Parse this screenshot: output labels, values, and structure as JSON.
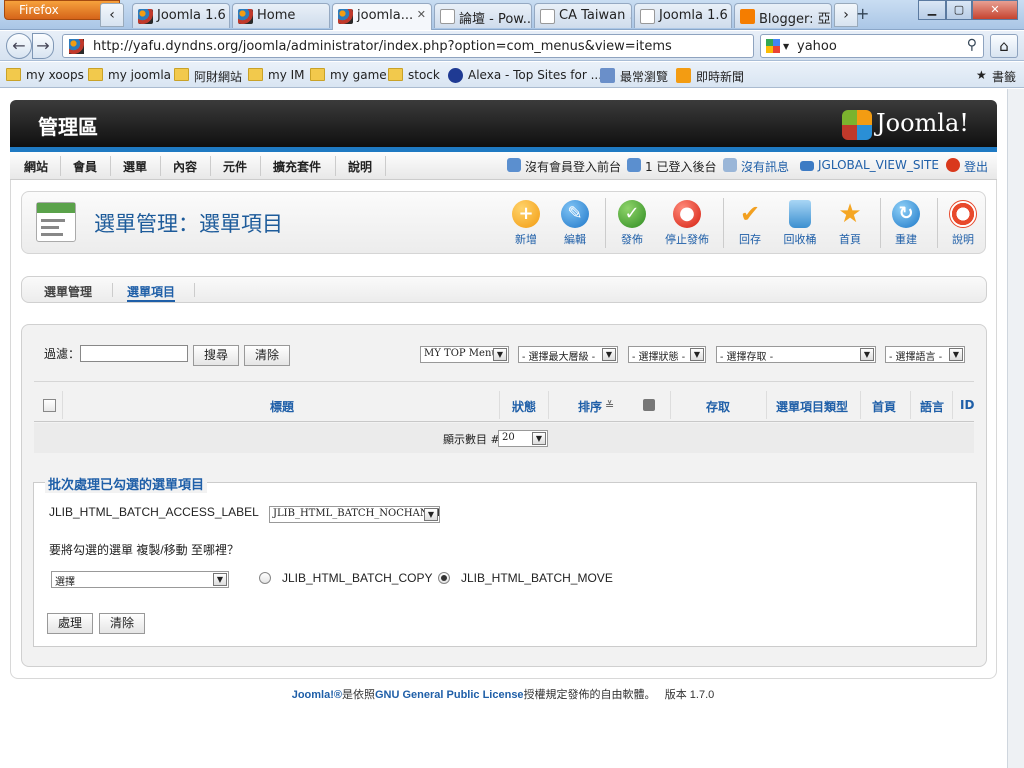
{
  "browser": {
    "app_button": "Firefox",
    "tabs": [
      {
        "label": "Joomla 1.6 ...",
        "icon": "joomla-favicon"
      },
      {
        "label": "Home",
        "icon": "joomla-favicon"
      },
      {
        "label": "joomla...",
        "icon": "joomla-favicon",
        "active": true
      },
      {
        "label": "論壇 - Pow...",
        "icon": "page-favicon"
      },
      {
        "label": "CA Taiwan ...",
        "icon": "page-favicon"
      },
      {
        "label": "Joomla 1.6 ...",
        "icon": "page-favicon"
      },
      {
        "label": "Blogger: 亞...",
        "icon": "blogger-favicon"
      }
    ],
    "tab_left_arrow": "‹",
    "tab_right_arrow": "›",
    "new_tab": "+",
    "url": "http://yafu.dyndns.org/joomla/administrator/index.php?option=com_menus&view=items",
    "search_value": "yahoo",
    "bookmarks": [
      "my xoops",
      "my joomla",
      "阿財網站",
      "my IM",
      "my game",
      "stock",
      "Alexa - Top Sites for ...",
      "最常瀏覽",
      "即時新聞"
    ],
    "bookmarks_menu": "書籤"
  },
  "admin": {
    "header_title": "管理區",
    "logo_text": "Joomla!",
    "menu": [
      "網站",
      "會員",
      "選單",
      "內容",
      "元件",
      "擴充套件",
      "說明"
    ],
    "status": {
      "frontend": "沒有會員登入前台",
      "backend_count": "1",
      "backend": "已登入後台",
      "messages": "沒有訊息",
      "view_site": "JGLOBAL_VIEW_SITE",
      "logout": "登出"
    },
    "page_title": "選單管理：選單項目",
    "toolbar": {
      "new": "新增",
      "edit": "編輯",
      "publish": "發佈",
      "unpublish": "停止發佈",
      "checkin": "回存",
      "trash": "回收桶",
      "home": "首頁",
      "rebuild": "重建",
      "help": "說明"
    },
    "subnav": [
      "選單管理",
      "選單項目"
    ],
    "filter": {
      "label": "過濾：",
      "search_button": "搜尋",
      "clear_button": "清除",
      "menu_select": "MY TOP Menu",
      "level_select": "- 選擇最大層級 -",
      "state_select": "- 選擇狀態 -",
      "access_select": "- 選擇存取 -",
      "language_select": "- 選擇語言 -"
    },
    "columns": {
      "title": "標題",
      "status": "狀態",
      "ordering": "排序",
      "access": "存取",
      "menu_item_type": "選單項目類型",
      "home": "首頁",
      "language": "語言",
      "id": "ID"
    },
    "display": {
      "label": "顯示數目 #",
      "value": "20"
    },
    "batch": {
      "legend": "批次處理已勾選的選單項目",
      "access_label": "JLIB_HTML_BATCH_ACCESS_LABEL",
      "access_select": "JLIB_HTML_BATCH_NOCHANGE",
      "copy_move_prompt": "要將勾選的選單 複製/移動 至哪裡？",
      "target_select": "選擇",
      "copy_label": "JLIB_HTML_BATCH_COPY",
      "move_label": "JLIB_HTML_BATCH_MOVE",
      "process_button": "處理",
      "clear_button": "清除"
    },
    "footer": {
      "joomla": "Joomla!®",
      "text1": "是依照",
      "license": "GNU General Public License",
      "text2": "授權規定發佈的自由軟體。",
      "version_label": "版本",
      "version": "1.7.0"
    }
  }
}
